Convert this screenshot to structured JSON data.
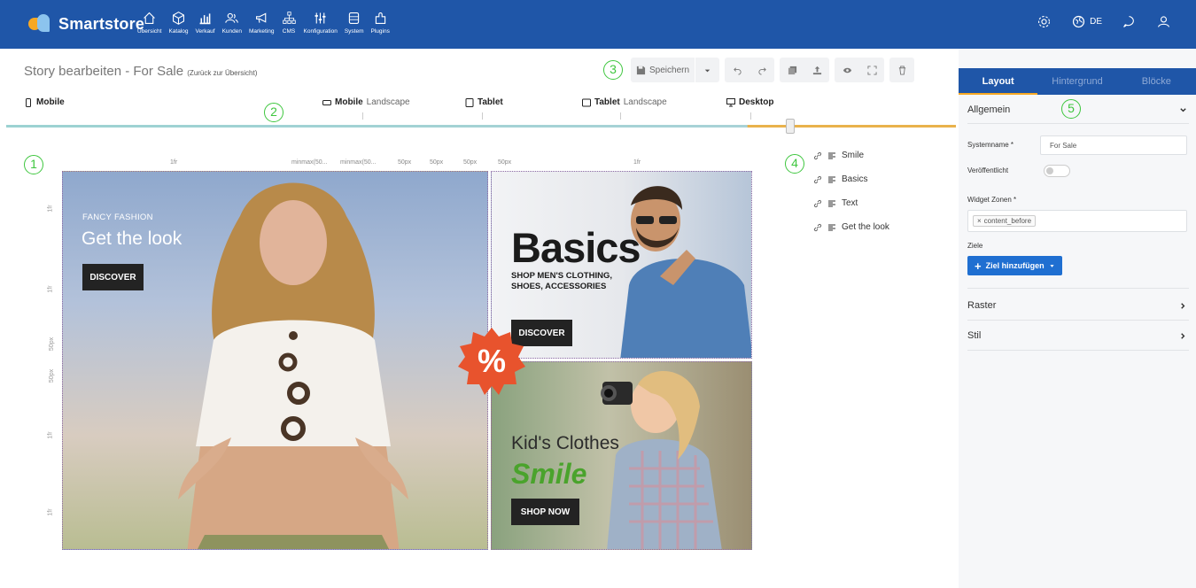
{
  "app": {
    "brand": "Smartstore",
    "nav": [
      {
        "label": "Übersicht",
        "icon": "home-icon"
      },
      {
        "label": "Katalog",
        "icon": "cube-icon"
      },
      {
        "label": "Verkauf",
        "icon": "chart-icon"
      },
      {
        "label": "Kunden",
        "icon": "users-icon"
      },
      {
        "label": "Marketing",
        "icon": "megaphone-icon"
      },
      {
        "label": "CMS",
        "icon": "sitemap-icon"
      },
      {
        "label": "Konfiguration",
        "icon": "sliders-icon"
      },
      {
        "label": "System",
        "icon": "database-icon"
      },
      {
        "label": "Plugins",
        "icon": "puzzle-icon"
      }
    ],
    "top_right": {
      "lang": "DE"
    }
  },
  "editor": {
    "title": "Story bearbeiten - For Sale",
    "back_link": "(Zurück zur Übersicht)",
    "save_label": "Speichern",
    "markers": [
      "1",
      "2",
      "3",
      "4",
      "5"
    ]
  },
  "devices": [
    {
      "bold": "Mobile",
      "light": "",
      "icon": "mobile-icon"
    },
    {
      "bold": "Mobile",
      "light": "Landscape",
      "icon": "mobile-landscape-icon"
    },
    {
      "bold": "Tablet",
      "light": "",
      "icon": "tablet-icon"
    },
    {
      "bold": "Tablet",
      "light": "Landscape",
      "icon": "tablet-landscape-icon"
    },
    {
      "bold": "Desktop",
      "light": "",
      "icon": "desktop-icon"
    }
  ],
  "grid": {
    "columns": [
      "1fr",
      "minmax(50...",
      "minmax(50...",
      "50px",
      "50px",
      "50px",
      "50px",
      "1fr"
    ],
    "rows": [
      "1fr",
      "1fr",
      "50px",
      "50px",
      "1fr",
      "1fr"
    ]
  },
  "blocks": {
    "fashion": {
      "eyebrow": "FANCY FASHION",
      "headline": "Get the look",
      "button": "DISCOVER"
    },
    "basics": {
      "headline": "Basics",
      "sub": "SHOP MEN'S CLOTHING, SHOES, ACCESSORIES",
      "button": "DISCOVER"
    },
    "kids": {
      "headline": "Kid's Clothes",
      "accent": "Smile",
      "button": "SHOP NOW"
    },
    "badge": "%"
  },
  "outline": [
    "Smile",
    "Basics",
    "Text",
    "Get the look"
  ],
  "panel": {
    "tabs": [
      "Layout",
      "Hintergrund",
      "Blöcke"
    ],
    "sections": {
      "allgemein": "Allgemein",
      "raster": "Raster",
      "stil": "Stil"
    },
    "fields": {
      "systemname_label": "Systemname *",
      "systemname_value": "For Sale",
      "published_label": "Veröffentlicht",
      "widget_label": "Widget Zonen *",
      "widget_chip": "content_before",
      "ziele_label": "Ziele",
      "add_target": "Ziel hinzufügen"
    }
  }
}
